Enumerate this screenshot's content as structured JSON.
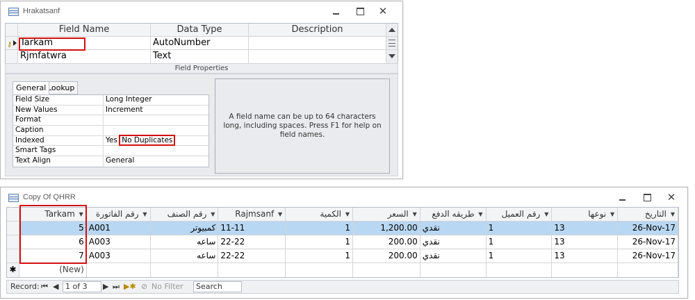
{
  "design_window": {
    "title": "Hrakatsanf",
    "columns": [
      "Field Name",
      "Data Type",
      "Description"
    ],
    "fields": [
      {
        "name": "Tarkam",
        "type": "AutoNumber",
        "description": ""
      },
      {
        "name": "Rjmfatwra",
        "type": "Text",
        "description": ""
      }
    ],
    "field_properties_label": "Field Properties",
    "tabs": [
      "General",
      "Lookup"
    ],
    "properties": [
      {
        "name": "Field Size",
        "value": "Long Integer"
      },
      {
        "name": "New Values",
        "value": "Increment"
      },
      {
        "name": "Format",
        "value": ""
      },
      {
        "name": "Caption",
        "value": ""
      },
      {
        "name": "Indexed",
        "value": "Yes",
        "value_highlight": "No Duplicates"
      },
      {
        "name": "Smart Tags",
        "value": ""
      },
      {
        "name": "Text Align",
        "value": "General"
      }
    ],
    "hint": "A field name can be up to 64 characters long, including spaces. Press F1 for help on field names."
  },
  "datasheet_window": {
    "title": "Copy Of QHRR",
    "headers": [
      "Tarkam",
      "رقم الفاتورة",
      "رقم الصنف",
      "Rajmsanf",
      "الكمية",
      "السعر",
      "طريقه الدفع",
      "رقم العميل",
      "نوعها",
      "التاريخ"
    ],
    "rows": [
      [
        "5",
        "A001",
        "كمبيوتر",
        "11-11",
        "1",
        "1,200.00",
        "نقدي",
        "1",
        "13",
        "26-Nov-17"
      ],
      [
        "6",
        "A003",
        "ساعه",
        "22-22",
        "1",
        "200.00",
        "نقدي",
        "1",
        "13",
        "26-Nov-17"
      ],
      [
        "7",
        "A003",
        "ساعه",
        "22-22",
        "1",
        "200.00",
        "نقدي",
        "1",
        "13",
        "26-Nov-17"
      ]
    ],
    "new_row_label": "(New)",
    "new_row_marker": "✱",
    "nav": {
      "record_label": "Record:",
      "position": "1 of 3",
      "filter_label": "No Filter",
      "search_label": "Search"
    }
  },
  "colors": {
    "highlight_red": "#d11010",
    "selected_row": "#b8d7f2"
  }
}
